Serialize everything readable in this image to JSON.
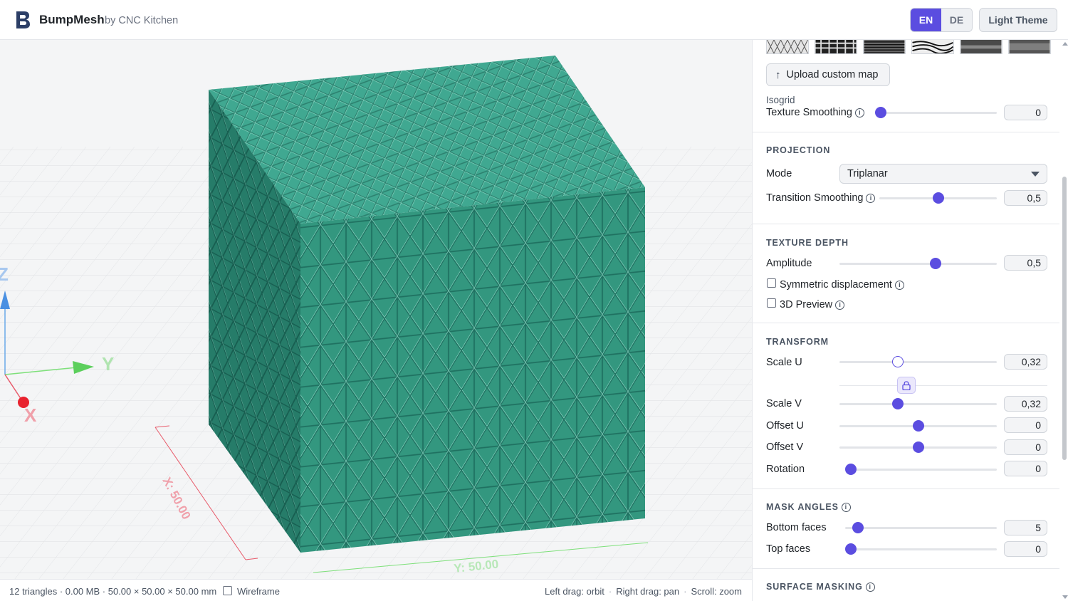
{
  "header": {
    "title": "BumpMesh",
    "subtitle": "by CNC Kitchen",
    "languages": [
      "EN",
      "DE"
    ],
    "active_language": "EN",
    "theme_label": "Light Theme",
    "brand_color": "#5b4de0"
  },
  "viewport": {
    "axes": {
      "z": "Z",
      "y": "Y",
      "x": "X"
    },
    "dim_x": "X: 50.00",
    "dim_y": "Y: 50.00",
    "mesh_color": "#3a9e8a"
  },
  "status": {
    "stats": "12 triangles · 0.00 MB · 50.00 × 50.00 × 50.00 mm",
    "wireframe_label": "Wireframe",
    "wireframe_checked": false,
    "hint_orbit": "Left drag: orbit",
    "hint_pan": "Right drag: pan",
    "hint_zoom": "Scroll: zoom",
    "separator": "·"
  },
  "panel": {
    "texture": {
      "upload_label": "Upload custom map",
      "selected_name": "Isogrid",
      "smoothing_label": "Texture Smoothing",
      "smoothing_value": "0",
      "smoothing_fraction": 0.0
    },
    "projection": {
      "title": "PROJECTION",
      "mode_label": "Mode",
      "mode_value": "Triplanar",
      "transition_label": "Transition Smoothing",
      "transition_value": "0,5",
      "transition_fraction": 0.5
    },
    "depth": {
      "title": "TEXTURE DEPTH",
      "amplitude_label": "Amplitude",
      "amplitude_value": "0,5",
      "amplitude_fraction": 0.62,
      "symmetric_label": "Symmetric displacement",
      "preview_label": "3D Preview"
    },
    "transform": {
      "title": "TRANSFORM",
      "scale_u_label": "Scale U",
      "scale_u_value": "0,32",
      "scale_u_fraction": 0.36,
      "scale_v_label": "Scale V",
      "scale_v_value": "0,32",
      "scale_v_fraction": 0.36,
      "offset_u_label": "Offset U",
      "offset_u_value": "0",
      "offset_u_fraction": 0.5,
      "offset_v_label": "Offset V",
      "offset_v_value": "0",
      "offset_v_fraction": 0.5,
      "rotation_label": "Rotation",
      "rotation_value": "0",
      "rotation_fraction": 0.0
    },
    "mask": {
      "title": "MASK ANGLES",
      "bottom_label": "Bottom faces",
      "bottom_value": "5",
      "bottom_fraction": 0.05,
      "top_label": "Top faces",
      "top_value": "0",
      "top_fraction": 0.0
    },
    "surface": {
      "title": "SURFACE MASKING"
    }
  }
}
